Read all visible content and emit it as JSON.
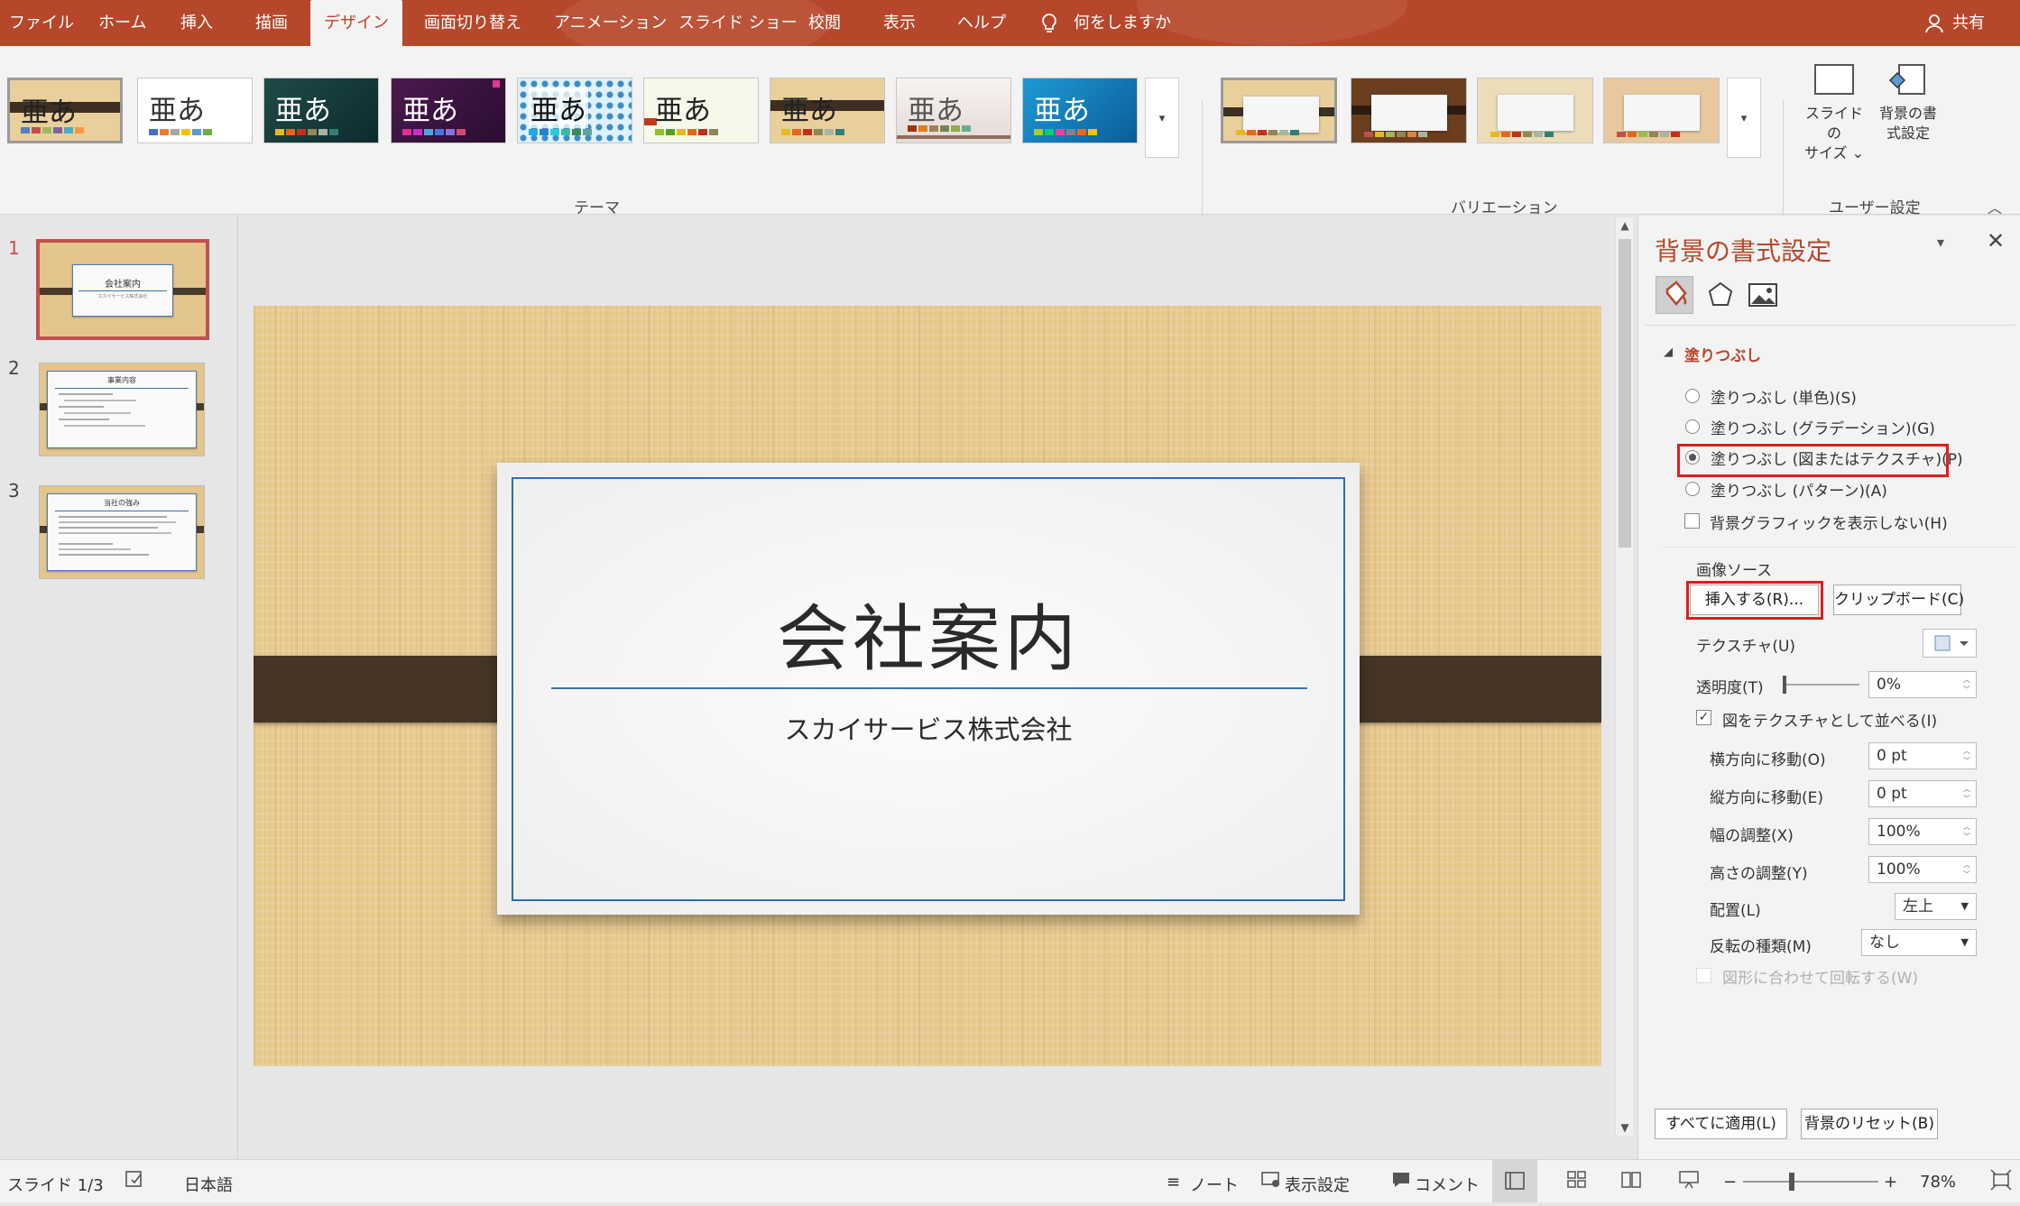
{
  "ribbon_tabs": [
    "ファイル",
    "ホーム",
    "挿入",
    "描画",
    "デザイン",
    "画面切り替え",
    "アニメーション",
    "スライド ショー",
    "校閲",
    "表示",
    "ヘルプ"
  ],
  "tell_me": "何をしますか",
  "share": "共有",
  "ribbon": {
    "theme_sample": "亜あ",
    "theme_group": "テーマ",
    "variation_group": "バリエーション",
    "slide_size": [
      "スライドの",
      "サイズ ⌄"
    ],
    "format_background": [
      "背景の書",
      "式設定"
    ],
    "user_group": "ユーザー設定"
  },
  "slides": [
    {
      "num": "1",
      "title": "会社案内",
      "sub": "スカイサービス株式会社"
    },
    {
      "num": "2",
      "title": "事業内容"
    },
    {
      "num": "3",
      "title": "当社の強み"
    }
  ],
  "slide": {
    "title": "会社案内",
    "subtitle": "スカイサービス株式会社"
  },
  "pane": {
    "title": "背景の書式設定",
    "fill_header": "塗りつぶし",
    "options": [
      "塗りつぶし (単色)(S)",
      "塗りつぶし (グラデーション)(G)",
      "塗りつぶし (図またはテクスチャ)(P)",
      "塗りつぶし (パターン)(A)"
    ],
    "hide_graphics": "背景グラフィックを表示しない(H)",
    "image_source": "画像ソース",
    "insert_btn": "挿入する(R)...",
    "clipboard_btn": "クリップボード(C)",
    "texture": "テクスチャ(U)",
    "transparency": "透明度(T)",
    "transparency_value": "0%",
    "tile": "図をテクスチャとして並べる(I)",
    "offset_x": "横方向に移動(O)",
    "offset_x_value": "0 pt",
    "offset_y": "縦方向に移動(E)",
    "offset_y_value": "0 pt",
    "scale_x": "幅の調整(X)",
    "scale_x_value": "100%",
    "scale_y": "高さの調整(Y)",
    "scale_y_value": "100%",
    "alignment": "配置(L)",
    "alignment_value": "左上",
    "mirror": "反転の種類(M)",
    "mirror_value": "なし",
    "rotate": "図形に合わせて回転する(W)",
    "apply_all": "すべてに適用(L)",
    "reset": "背景のリセット(B)"
  },
  "status": {
    "slide": "スライド 1/3",
    "lang": "日本語",
    "notes": "ノート",
    "display": "表示設定",
    "comments": "コメント",
    "zoom": "78%"
  },
  "colors": {
    "accent": "#b7472a",
    "highlight": "#e01d1d"
  }
}
